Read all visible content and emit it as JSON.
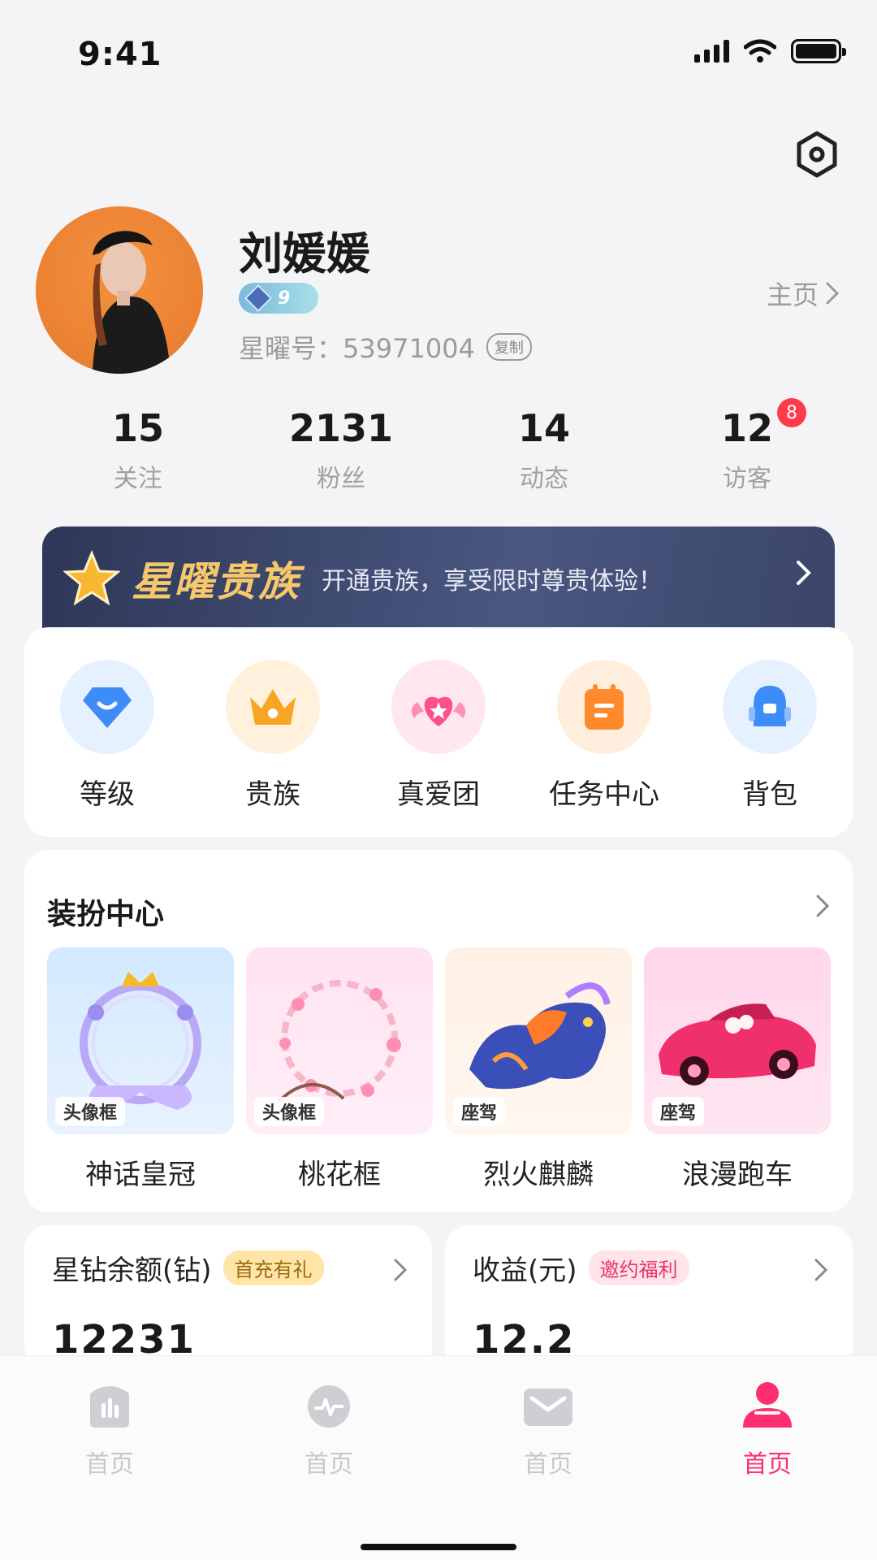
{
  "status_bar": {
    "time": "9:41"
  },
  "profile": {
    "name": "刘媛媛",
    "level": "9",
    "id_label": "星曜号：",
    "id_value": "53971004",
    "copy_label": "复制",
    "home_link": "主页"
  },
  "stats": [
    {
      "value": "15",
      "label": "关注"
    },
    {
      "value": "2131",
      "label": "粉丝"
    },
    {
      "value": "14",
      "label": "动态"
    },
    {
      "value": "12",
      "label": "访客",
      "badge": "8"
    }
  ],
  "vip_banner": {
    "title": "星曜贵族",
    "subtitle": "开通贵族，享受限时尊贵体验！"
  },
  "quick_menu": [
    {
      "label": "等级",
      "icon": "diamond-icon",
      "bg": "#e6f1ff",
      "color": "#3e8cf7"
    },
    {
      "label": "贵族",
      "icon": "crown-icon",
      "bg": "#fff1dc",
      "color": "#f6a623"
    },
    {
      "label": "真爱团",
      "icon": "heart-wings-icon",
      "bg": "#ffe6ef",
      "color": "#ff4f8b"
    },
    {
      "label": "任务中心",
      "icon": "clipboard-icon",
      "bg": "#ffeedd",
      "color": "#ff8a2b"
    },
    {
      "label": "背包",
      "icon": "backpack-icon",
      "bg": "#e6f1ff",
      "color": "#3e8cf7"
    }
  ],
  "dress_center": {
    "title": "装扮中心",
    "items": [
      {
        "name": "神话皇冠",
        "tag": "头像框"
      },
      {
        "name": "桃花框",
        "tag": "头像框"
      },
      {
        "name": "烈火麒麟",
        "tag": "座驾"
      },
      {
        "name": "浪漫跑车",
        "tag": "座驾"
      }
    ]
  },
  "wallet": {
    "title": "星钻余额(钻)",
    "tag": "首充有礼",
    "value": "12231"
  },
  "earnings": {
    "title": "收益(元)",
    "tag": "邀约福利",
    "value": "12.2"
  },
  "tabbar": [
    {
      "label": "首页",
      "icon": "bars-icon",
      "active": false
    },
    {
      "label": "首页",
      "icon": "pulse-icon",
      "active": false
    },
    {
      "label": "首页",
      "icon": "mail-icon",
      "active": false
    },
    {
      "label": "首页",
      "icon": "user-icon",
      "active": true
    }
  ],
  "colors": {
    "accent": "#ff2e6d",
    "vip_gold": "#f6c86b",
    "vip_bg": "#2d3757"
  }
}
